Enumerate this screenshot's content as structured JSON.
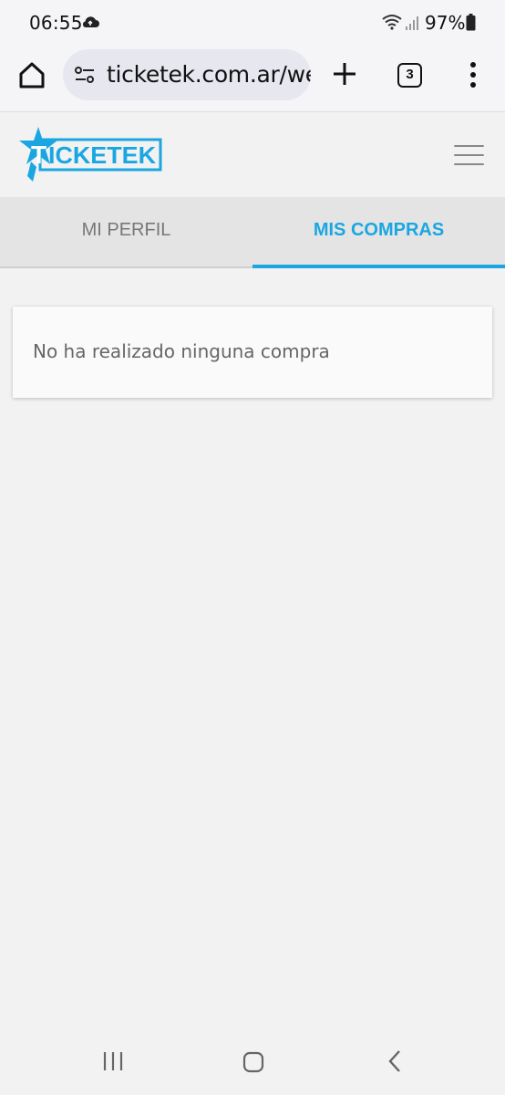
{
  "status_bar": {
    "time": "06:55",
    "battery": "97%",
    "icons": [
      "cloud-icon",
      "wifi-icon",
      "signal-icon",
      "battery-icon"
    ]
  },
  "browser": {
    "url": "ticketek.com.ar/web",
    "tab_count": "3",
    "icons": [
      "home-icon",
      "site-settings-icon",
      "plus-icon",
      "tabs-icon",
      "more-vert-icon"
    ]
  },
  "site": {
    "logo_text": "TICKETEK",
    "brand_color": "#1aa7e1",
    "menu_icon": "hamburger-icon"
  },
  "tabs": [
    {
      "label": "MI PERFIL",
      "active": false
    },
    {
      "label": "MIS COMPRAS",
      "active": true
    }
  ],
  "content": {
    "empty_message": "No ha realizado ninguna compra"
  },
  "nav_bar": {
    "icons": [
      "recent-apps-icon",
      "home-nav-icon",
      "back-icon"
    ]
  }
}
